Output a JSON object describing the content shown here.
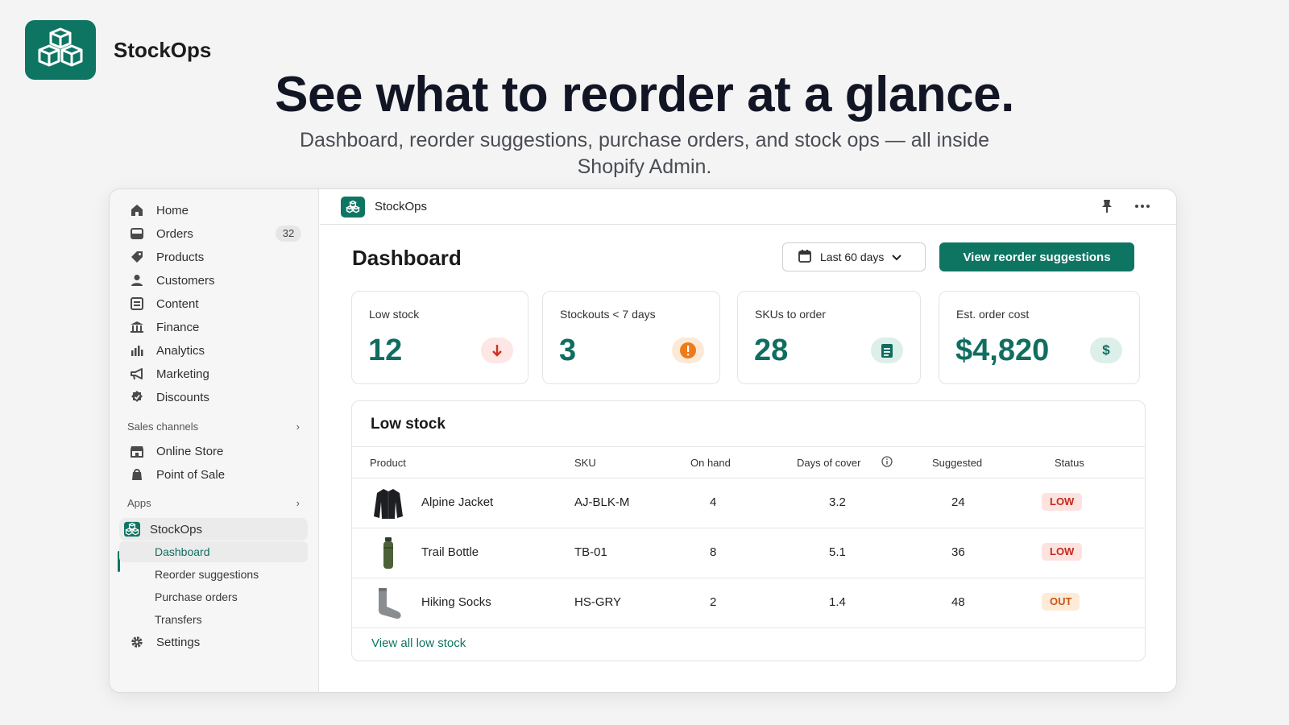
{
  "brand": {
    "name": "StockOps",
    "accent": "#0f7563"
  },
  "hero": {
    "headline": "See what to reorder at a glance.",
    "subline": "Dashboard, reorder suggestions, purchase orders, and stock ops — all inside Shopify Admin."
  },
  "sidebar": {
    "items": [
      {
        "label": "Home",
        "icon": "home-icon"
      },
      {
        "label": "Orders",
        "icon": "orders-icon",
        "badge": "32"
      },
      {
        "label": "Products",
        "icon": "tag-icon"
      },
      {
        "label": "Customers",
        "icon": "person-icon"
      },
      {
        "label": "Content",
        "icon": "content-icon"
      },
      {
        "label": "Finance",
        "icon": "bank-icon"
      },
      {
        "label": "Analytics",
        "icon": "bar-chart-icon"
      },
      {
        "label": "Marketing",
        "icon": "megaphone-icon"
      },
      {
        "label": "Discounts",
        "icon": "discount-icon"
      }
    ],
    "sales_channels_label": "Sales channels",
    "sales_channels": [
      {
        "label": "Online Store",
        "icon": "store-icon"
      },
      {
        "label": "Point of Sale",
        "icon": "pos-icon"
      }
    ],
    "apps_label": "Apps",
    "app_name": "StockOps",
    "app_subitems": [
      "Dashboard",
      "Reorder suggestions",
      "Purchase orders",
      "Transfers"
    ],
    "settings_label": "Settings"
  },
  "topbar": {
    "title": "StockOps"
  },
  "dashboard": {
    "title": "Dashboard",
    "date_range": "Last 60 days",
    "primary_action": "View reorder suggestions",
    "stats": [
      {
        "label": "Low stock",
        "value": "12",
        "icon": "arrow-down-icon"
      },
      {
        "label": "Stockouts < 7 days",
        "value": "3",
        "icon": "alert-icon"
      },
      {
        "label": "SKUs to order",
        "value": "28",
        "icon": "clipboard-icon"
      },
      {
        "label": "Est. order cost",
        "value": "$4,820",
        "icon": "dollar-icon"
      }
    ]
  },
  "low_stock": {
    "title": "Low stock",
    "columns": [
      "Product",
      "SKU",
      "On hand",
      "Days of cover",
      "Suggested",
      "Status"
    ],
    "rows": [
      {
        "product": "Alpine Jacket",
        "sku": "AJ-BLK-M",
        "on_hand": "4",
        "days": "3.2",
        "suggested": "24",
        "status": "LOW"
      },
      {
        "product": "Trail Bottle",
        "sku": "TB-01",
        "on_hand": "8",
        "days": "5.1",
        "suggested": "36",
        "status": "LOW"
      },
      {
        "product": "Hiking Socks",
        "sku": "HS-GRY",
        "on_hand": "2",
        "days": "1.4",
        "suggested": "48",
        "status": "OUT"
      }
    ],
    "view_all": "View all low stock"
  }
}
